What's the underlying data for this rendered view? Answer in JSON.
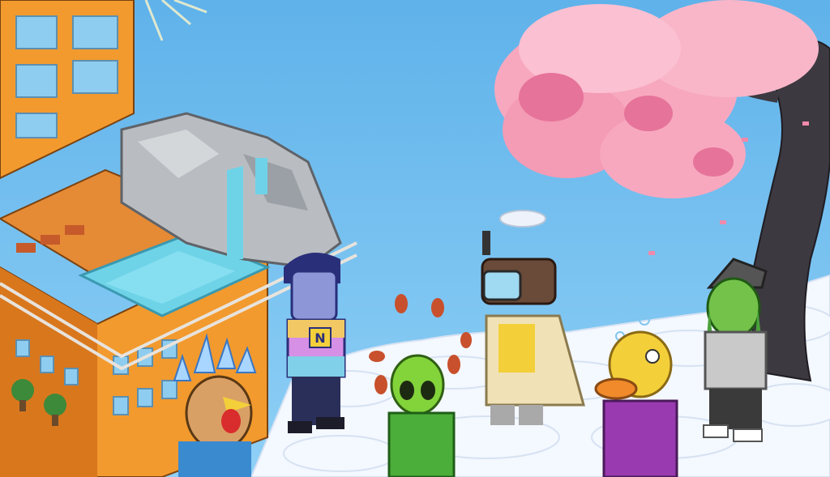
{
  "scene": {
    "palette": {
      "sky_top": "#5fb2ea",
      "sky_bottom": "#8fd0f6",
      "building_orange": "#f29a2e",
      "building_shadow": "#d9771d",
      "window_blue": "#8ecdf0",
      "rock_grey": "#b9bdc2",
      "water": "#6fd3e8",
      "blossom_pink": "#f7a8bf",
      "blossom_dark": "#e6739a",
      "trunk": "#3d3940",
      "cloud": "#f4f8ff"
    },
    "objects": [
      {
        "name": "building-tower",
        "description_icon": "building-icon"
      },
      {
        "name": "rooftop-pool",
        "description_icon": "pool-icon"
      },
      {
        "name": "rock-waterfall",
        "description_icon": "waterfall-icon"
      },
      {
        "name": "cherry-blossom-tree",
        "description_icon": "tree-icon"
      },
      {
        "name": "cloud-floor",
        "description_icon": "cloud-icon"
      }
    ],
    "avatars": [
      {
        "name": "avatar-rooster",
        "shirt_letter": ""
      },
      {
        "name": "avatar-rainbow-shirt",
        "shirt_letter": "N"
      },
      {
        "name": "avatar-alien",
        "shirt_letter": ""
      },
      {
        "name": "avatar-cloak-goggles",
        "shirt_letter": ""
      },
      {
        "name": "avatar-duck",
        "shirt_letter": ""
      },
      {
        "name": "avatar-green-elf",
        "shirt_letter": ""
      }
    ]
  }
}
